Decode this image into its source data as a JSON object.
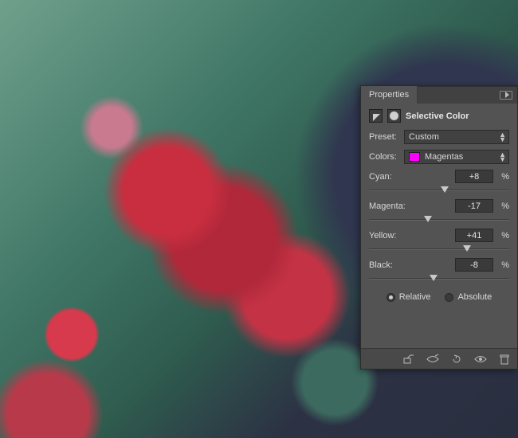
{
  "panel": {
    "tab_label": "Properties",
    "title": "Selective Color",
    "preset_label": "Preset:",
    "preset_value": "Custom",
    "colors_label": "Colors:",
    "colors_value": "Magentas",
    "colors_swatch": "#ff00ff",
    "sliders": {
      "cyan": {
        "label": "Cyan:",
        "value": "+8",
        "pos": 54
      },
      "magenta": {
        "label": "Magenta:",
        "value": "-17",
        "pos": 42
      },
      "yellow": {
        "label": "Yellow:",
        "value": "+41",
        "pos": 70
      },
      "black": {
        "label": "Black:",
        "value": "-8",
        "pos": 46
      }
    },
    "percent": "%",
    "mode": {
      "relative": "Relative",
      "absolute": "Absolute",
      "selected": "relative"
    }
  }
}
